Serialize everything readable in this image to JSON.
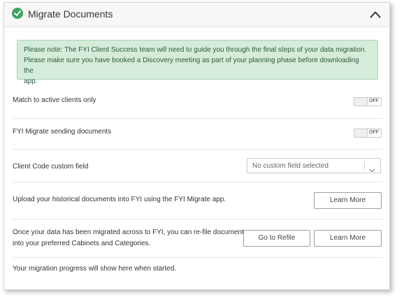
{
  "panel": {
    "title": "Migrate Documents",
    "icons": {
      "status": "check-circle-icon",
      "collapse": "chevron-up-icon"
    },
    "colors": {
      "success": "#3da461",
      "notice_bg": "#d4ecd9",
      "notice_text": "#2f5a3a"
    }
  },
  "notice": {
    "line1": "Please note: The FYI Client Success team will need to guide you through the final steps of your data migration.",
    "line2": "Please make sure you have booked a Discovery meeting as part of your planning phase before downloading the",
    "line3": "app."
  },
  "settings": {
    "match_active": {
      "label": "Match to active clients only",
      "state": "OFF"
    },
    "sending_documents": {
      "label": "FYI Migrate sending documents",
      "state": "OFF"
    },
    "client_code": {
      "label": "Client Code custom field",
      "selected": "No custom field selected"
    }
  },
  "upload": {
    "text": "Upload your historical documents into FYI using the FYI Migrate app.",
    "learn_more": "Learn More"
  },
  "refile": {
    "line1": "Once your data has been migrated across to FYI, you can re-file documents",
    "line2": "into your preferred Cabinets and Categories.",
    "go_to_refile": "Go to Refile",
    "learn_more": "Learn More"
  },
  "progress": {
    "text": "Your migration progress will show here when started."
  }
}
